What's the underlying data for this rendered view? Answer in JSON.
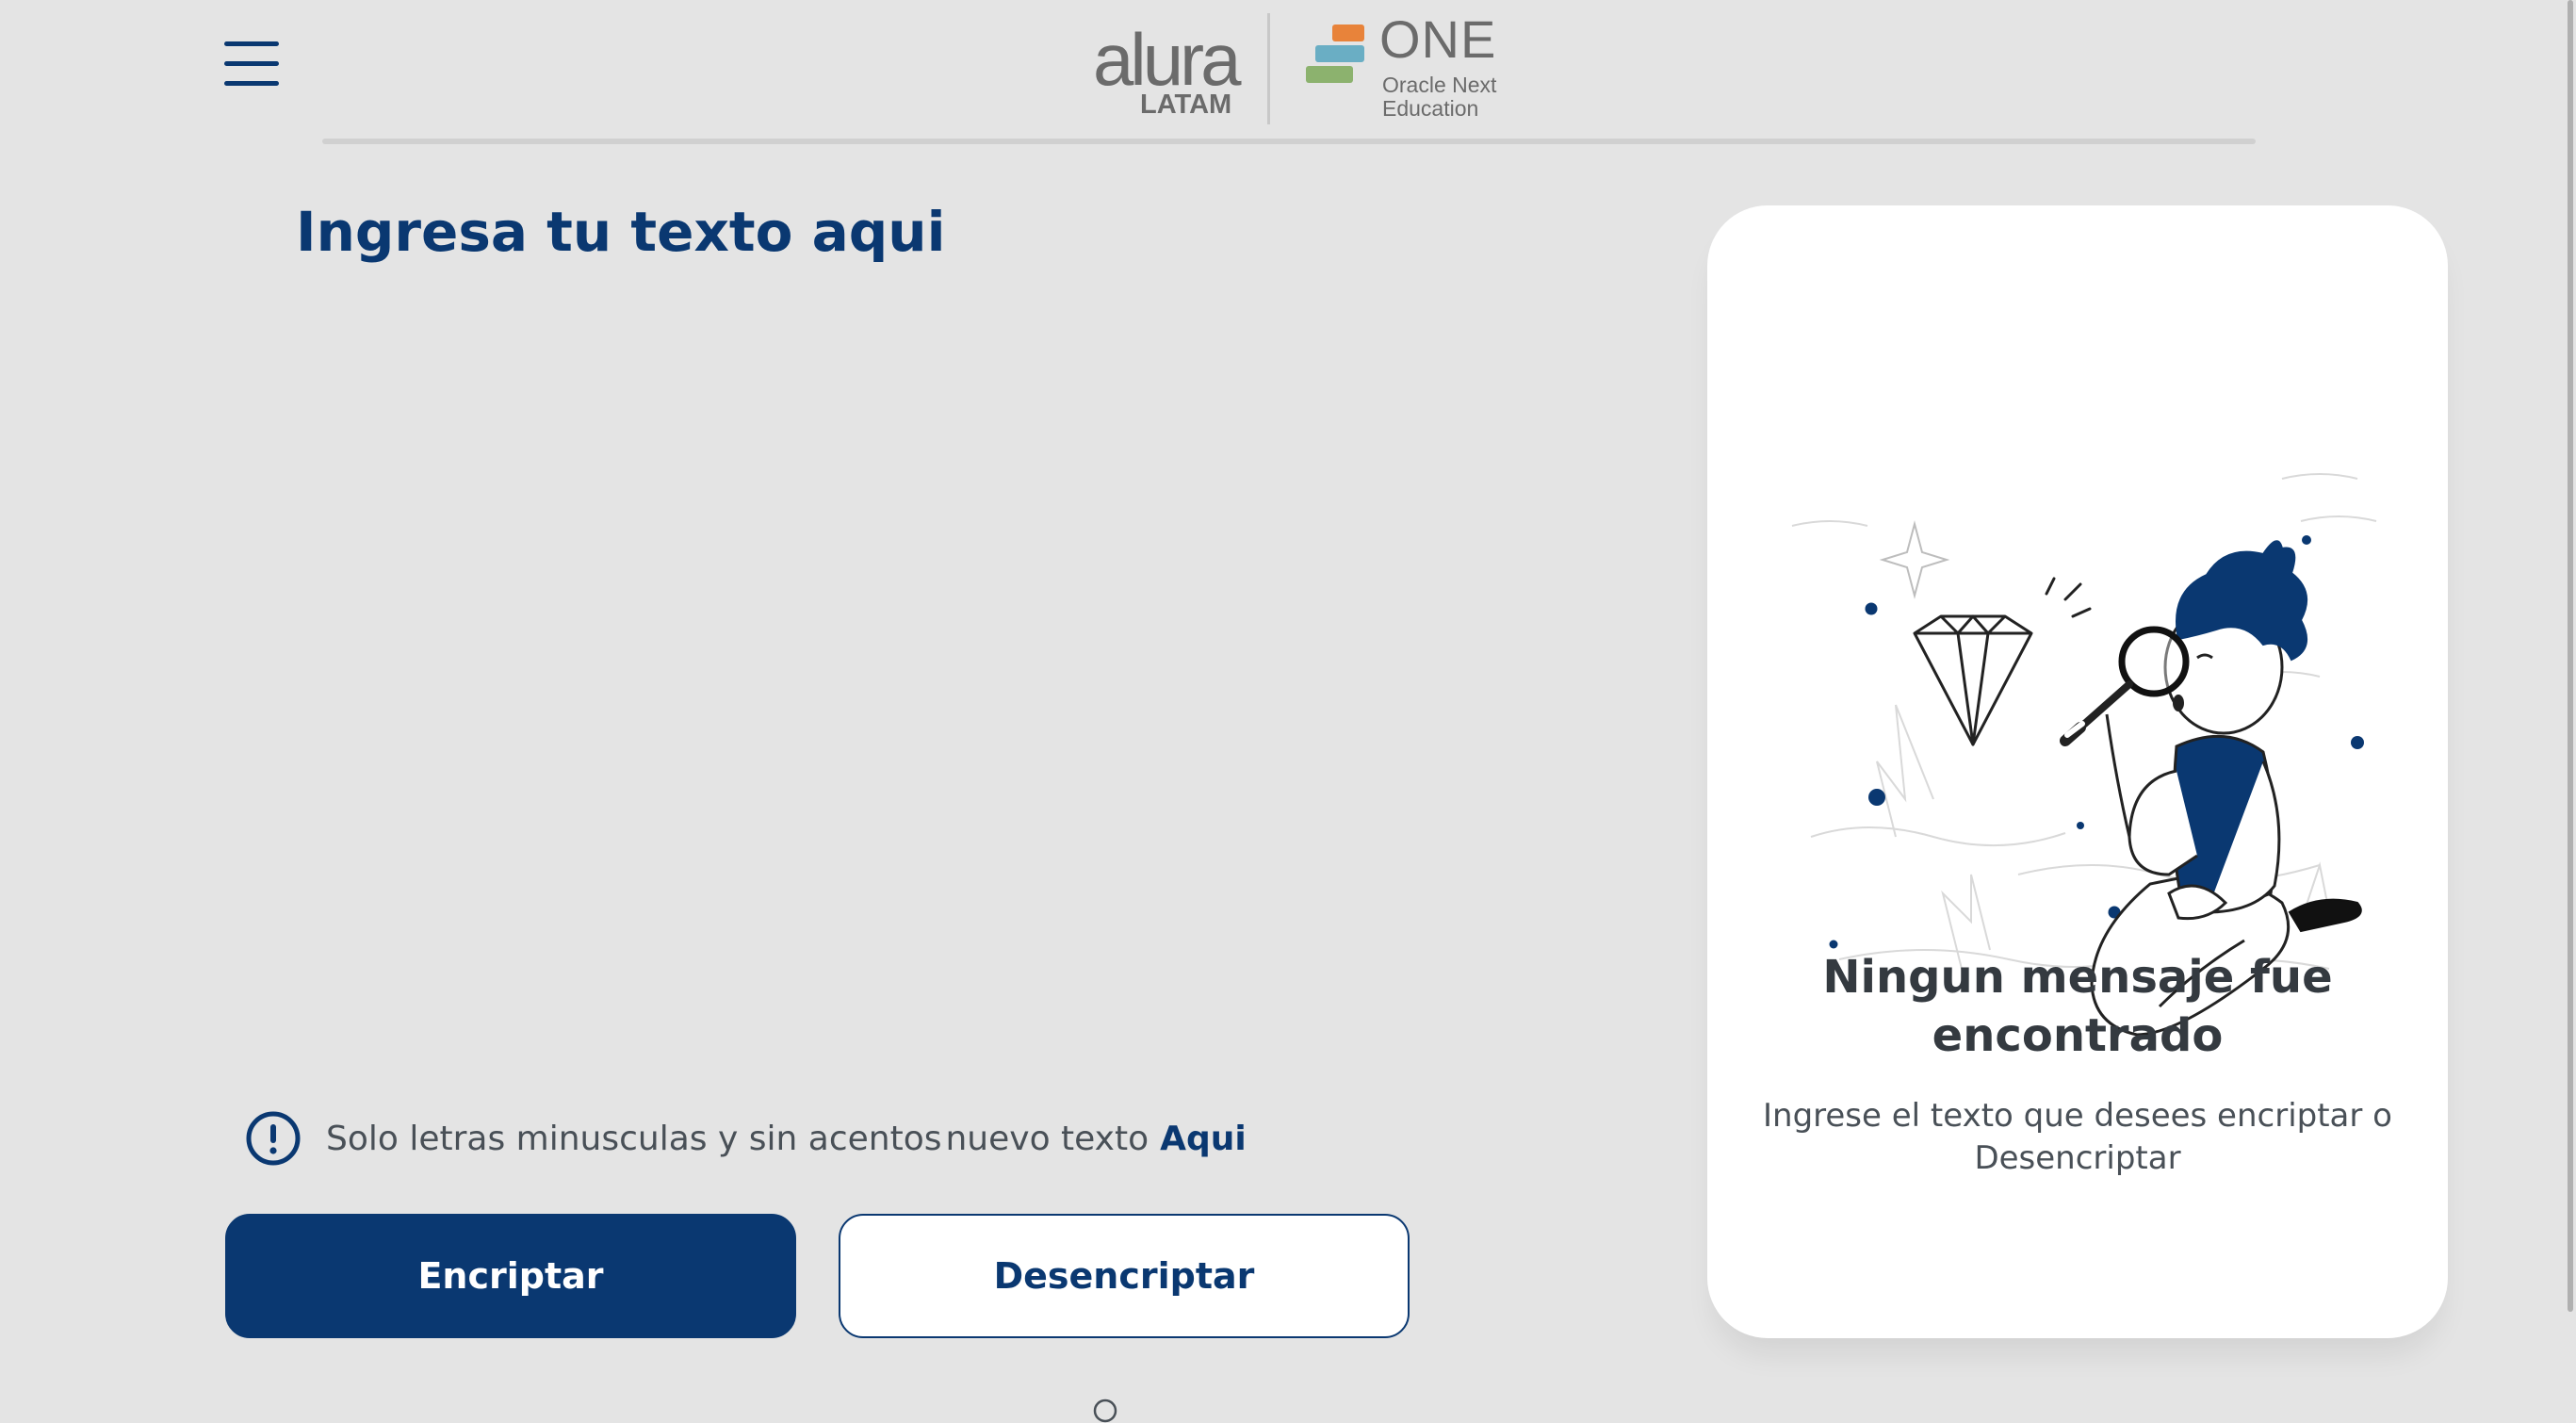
{
  "header": {
    "menu_icon": "hamburger-menu-icon",
    "logo_alura": {
      "name": "alura",
      "sub": "LATAM"
    },
    "logo_one": {
      "title": "ONE",
      "subtitle_line1": "Oracle Next",
      "subtitle_line2": "Education"
    }
  },
  "editor": {
    "placeholder": "Ingresa tu texto aqui"
  },
  "hint": {
    "icon": "exclamation-circle-icon",
    "text": "Solo letras minusculas y sin acentos",
    "new_text": "nuevo texto",
    "link": "Aqui"
  },
  "buttons": {
    "encrypt": "Encriptar",
    "decrypt": "Desencriptar"
  },
  "result": {
    "illustration": "person-with-magnifying-glass-and-diamond",
    "title": "Ningun mensaje fue encontrado",
    "description": "Ingrese el texto que desees encriptar o Desencriptar"
  },
  "colors": {
    "primary": "#0a3871",
    "background": "#e4e4e4",
    "panel": "#ffffff",
    "text_dark": "#343a40",
    "text_muted": "#495057"
  }
}
